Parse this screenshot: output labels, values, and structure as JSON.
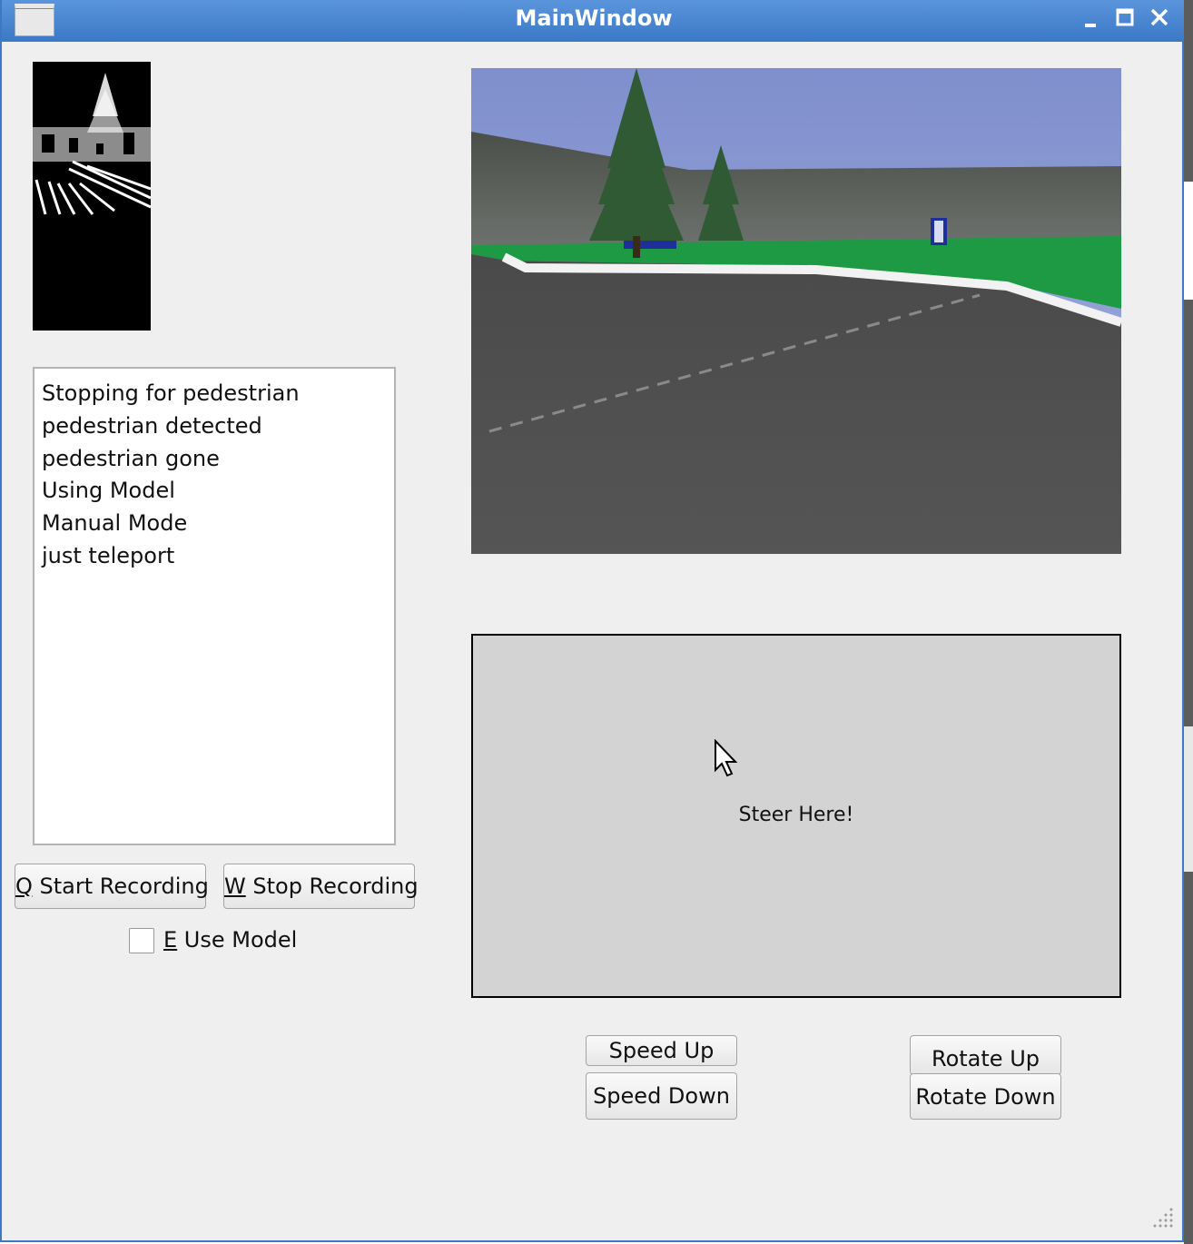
{
  "window": {
    "title": "MainWindow"
  },
  "log": {
    "lines": [
      "Stopping for pedestrian",
      "pedestrian detected",
      "pedestrian gone",
      "Using Model",
      "Manual Mode",
      "just teleport"
    ]
  },
  "controls": {
    "start_recording": {
      "key": "Q",
      "label": " Start Recording"
    },
    "stop_recording": {
      "key": "W",
      "label": " Stop Recording"
    },
    "use_model": {
      "key": "E",
      "label": " Use Model",
      "checked": false
    },
    "steer_label": "Steer Here!",
    "speed_up": "Speed Up",
    "speed_down": "Speed Down",
    "rotate_up": "Rotate Up",
    "rotate_down": "Rotate Down"
  },
  "colors": {
    "titlebar": "#3b78c6",
    "window_bg": "#efefef",
    "steer_bg": "#d3d3d3",
    "grass": "#1e9a44",
    "road": "#555555",
    "sky": "#8a9cd2"
  },
  "icons": {
    "minimize": "minimize-icon",
    "maximize": "maximize-icon",
    "close": "close-icon",
    "cursor": "mouse-cursor-icon"
  }
}
